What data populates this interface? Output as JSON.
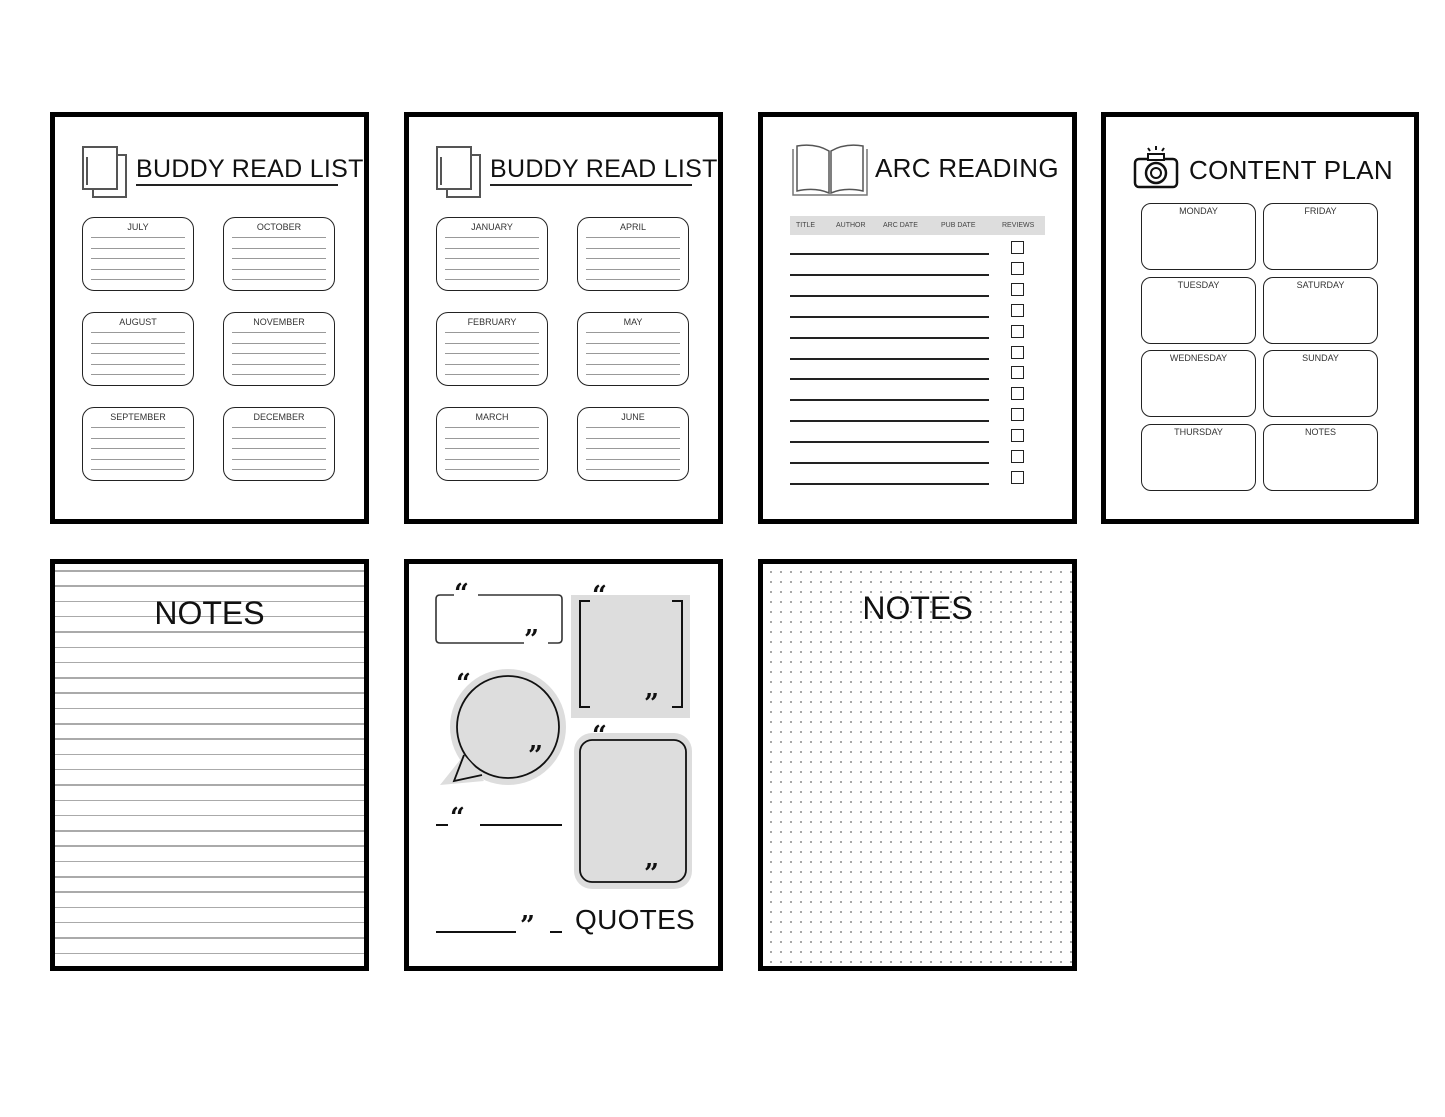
{
  "pages": {
    "buddy1": {
      "title": "BUDDY READ LIST",
      "icon": "books-icon",
      "months": [
        "JULY",
        "OCTOBER",
        "AUGUST",
        "NOVEMBER",
        "SEPTEMBER",
        "DECEMBER"
      ]
    },
    "buddy2": {
      "title": "BUDDY READ LIST",
      "icon": "books-icon",
      "months": [
        "JANUARY",
        "APRIL",
        "FEBRUARY",
        "MAY",
        "MARCH",
        "JUNE"
      ]
    },
    "arc": {
      "title": "ARC READING",
      "icon": "open-book-icon",
      "columns": [
        "TITLE",
        "AUTHOR",
        "ARC DATE",
        "PUB DATE",
        "REVIEWS"
      ]
    },
    "content": {
      "title": "CONTENT PLAN",
      "icon": "camera-icon",
      "days": [
        "MONDAY",
        "FRIDAY",
        "TUESDAY",
        "SATURDAY",
        "WEDNESDAY",
        "SUNDAY",
        "THURSDAY",
        "NOTES"
      ]
    },
    "notes_lined": {
      "title": "NOTES"
    },
    "quotes": {
      "title": "QUOTES",
      "open_quote": "“",
      "close_quote": "”"
    },
    "notes_dotted": {
      "title": "NOTES"
    }
  },
  "colors": {
    "border": "#000000",
    "fill_gray": "#dddddd",
    "line_gray": "#aaaaaa"
  }
}
